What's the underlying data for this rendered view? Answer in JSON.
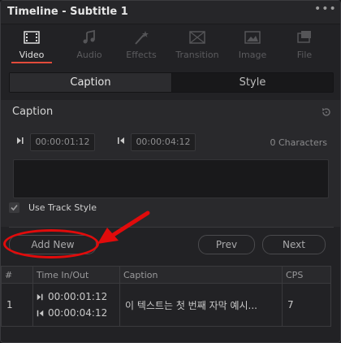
{
  "window": {
    "title": "Timeline - Subtitle 1",
    "menu_label": "•••"
  },
  "tabs": [
    {
      "label": "Video",
      "icon": "film-icon",
      "active": true
    },
    {
      "label": "Audio",
      "icon": "music-note-icon",
      "active": false
    },
    {
      "label": "Effects",
      "icon": "magic-wand-icon",
      "active": false
    },
    {
      "label": "Transition",
      "icon": "transition-icon",
      "active": false
    },
    {
      "label": "Image",
      "icon": "image-icon",
      "active": false
    },
    {
      "label": "File",
      "icon": "file-icon",
      "active": false
    }
  ],
  "segments": {
    "caption": "Caption",
    "style": "Style"
  },
  "caption_section": {
    "title": "Caption",
    "time_in": "00:00:01:12",
    "time_out": "00:00:04:12",
    "char_count": "0 Characters",
    "text_value": "",
    "use_track_style": "Use Track Style"
  },
  "buttons": {
    "add_new": "Add New",
    "prev": "Prev",
    "next": "Next"
  },
  "table": {
    "headers": [
      "#",
      "Time In/Out",
      "Caption",
      "CPS"
    ],
    "rows": [
      {
        "num": "1",
        "time_in": "00:00:01:12",
        "time_out": "00:00:04:12",
        "caption": "이 텍스트는 첫 번째 자막 예시...",
        "cps": "7"
      }
    ]
  },
  "colors": {
    "accent": "#e34b3b",
    "highlight": "#e10b0b"
  }
}
